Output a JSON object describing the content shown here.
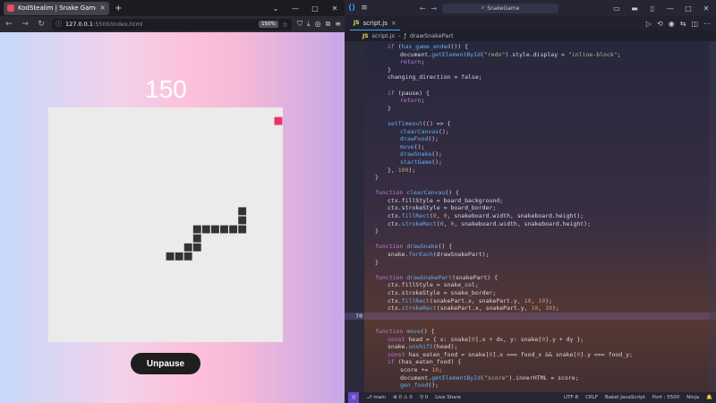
{
  "browser": {
    "tab_title": "KodStealim | Snake Game",
    "tab_close": "×",
    "new_tab": "+",
    "window_controls": [
      "⌄",
      "—",
      "□",
      "✕"
    ],
    "url_host": "127.0.0.1",
    "url_path": ":5500/index.html",
    "zoom": "150%",
    "nav_icons": [
      "back-icon",
      "forward-icon",
      "reload-icon"
    ]
  },
  "game": {
    "score": "150",
    "unpause_label": "Unpause",
    "board_background": "#ebebeb",
    "snake_color": "#333333",
    "food_color": "#e8336d",
    "grid_units": 26,
    "food": [
      25,
      1
    ],
    "snake": [
      [
        21,
        11
      ],
      [
        21,
        12
      ],
      [
        21,
        13
      ],
      [
        20,
        13
      ],
      [
        19,
        13
      ],
      [
        18,
        13
      ],
      [
        17,
        13
      ],
      [
        16,
        13
      ],
      [
        16,
        14
      ],
      [
        16,
        15
      ],
      [
        15,
        15
      ],
      [
        15,
        16
      ],
      [
        14,
        16
      ],
      [
        13,
        16
      ]
    ]
  },
  "vscode": {
    "title_search": "SnakeGame",
    "tab_label": "script.js",
    "tab_badge": "JS",
    "tab_close": "×",
    "breadcrumb_file": "script.js",
    "breadcrumb_sep": "›",
    "breadcrumb_fn": "drawSnakePart",
    "menu_icon": "≡",
    "nav_back": "←",
    "nav_fwd": "→",
    "search_icon": "⌕",
    "active_line": "70",
    "status": {
      "remote": "⟩⟨",
      "branch": "main",
      "errors": "⊗ 0 ⚠ 0",
      "ports": "⚲ 0",
      "live_share": "Live Share",
      "encoding": "UTF-8",
      "eol": "CRLF",
      "language": "Babel JavaScript",
      "port": "Port : 5500",
      "ninja": "Ninja",
      "notify": "🔔"
    }
  },
  "code_lines": [
    {
      "n": "",
      "html": "if (has_game_ended()) {",
      "indent": 1
    },
    {
      "n": "",
      "html": "document.getElementById(\"redo\").style.display = \"inline-block\";",
      "indent": 2
    },
    {
      "n": "",
      "html": "return;",
      "indent": 2
    },
    {
      "n": "",
      "html": "}",
      "indent": 1
    },
    {
      "n": "",
      "html": "changing_direction = false;",
      "indent": 1
    },
    {
      "n": "",
      "html": "",
      "indent": 0
    },
    {
      "n": "",
      "html": "if (pause) {",
      "indent": 1
    },
    {
      "n": "",
      "html": "return;",
      "indent": 2
    },
    {
      "n": "",
      "html": "}",
      "indent": 1
    },
    {
      "n": "",
      "html": "",
      "indent": 0
    },
    {
      "n": "",
      "html": "setTimeout(() => {",
      "indent": 1
    },
    {
      "n": "",
      "html": "clearCanvas();",
      "indent": 2
    },
    {
      "n": "",
      "html": "drawFood();",
      "indent": 2
    },
    {
      "n": "",
      "html": "move();",
      "indent": 2
    },
    {
      "n": "",
      "html": "drawSnake();",
      "indent": 2
    },
    {
      "n": "",
      "html": "startGame();",
      "indent": 2
    },
    {
      "n": "",
      "html": "}, 100);",
      "indent": 1
    },
    {
      "n": "",
      "html": "}",
      "indent": 0
    },
    {
      "n": "",
      "html": "",
      "indent": 0
    },
    {
      "n": "",
      "html": "function clearCanvas() {",
      "indent": 0
    },
    {
      "n": "",
      "html": "ctx.fillStyle = board_background;",
      "indent": 1
    },
    {
      "n": "",
      "html": "ctx.strokeStyle = board_border;",
      "indent": 1
    },
    {
      "n": "",
      "html": "ctx.fillRect(0, 0, snakeboard.width, snakeboard.height);",
      "indent": 1
    },
    {
      "n": "",
      "html": "ctx.strokeRect(0, 0, snakeboard.width, snakeboard.height);",
      "indent": 1
    },
    {
      "n": "",
      "html": "}",
      "indent": 0
    },
    {
      "n": "",
      "html": "",
      "indent": 0
    },
    {
      "n": "",
      "html": "function drawSnake() {",
      "indent": 0
    },
    {
      "n": "",
      "html": "snake.forEach(drawSnakePart);",
      "indent": 1
    },
    {
      "n": "",
      "html": "}",
      "indent": 0
    },
    {
      "n": "",
      "html": "",
      "indent": 0
    },
    {
      "n": "",
      "html": "function drawSnakePart(snakePart) {",
      "indent": 0
    },
    {
      "n": "",
      "html": "ctx.fillStyle = snake_col;",
      "indent": 1
    },
    {
      "n": "",
      "html": "ctx.strokeStyle = snake_border;",
      "indent": 1
    },
    {
      "n": "",
      "html": "ctx.fillRect(snakePart.x, snakePart.y, 10, 10);",
      "indent": 1
    },
    {
      "n": "",
      "html": "ctx.strokeRect(snakePart.x, snakePart.y, 10, 10);",
      "indent": 1
    },
    {
      "n": "70",
      "html": "",
      "indent": 0,
      "active": true
    },
    {
      "n": "",
      "html": "",
      "indent": 0
    },
    {
      "n": "",
      "html": "function move() {",
      "indent": 0
    },
    {
      "n": "",
      "html": "const head = { x: snake[0].x + dx, y: snake[0].y + dy };",
      "indent": 1
    },
    {
      "n": "",
      "html": "snake.unshift(head);",
      "indent": 1
    },
    {
      "n": "",
      "html": "const has_eaten_food = snake[0].x === food_x && snake[0].y === food_y;",
      "indent": 1
    },
    {
      "n": "",
      "html": "if (has_eaten_food) {",
      "indent": 1
    },
    {
      "n": "",
      "html": "score += 10;",
      "indent": 2
    },
    {
      "n": "",
      "html": "document.getElementById(\"score\").innerHTML = score;",
      "indent": 2
    },
    {
      "n": "",
      "html": "gen_food();",
      "indent": 2
    }
  ]
}
